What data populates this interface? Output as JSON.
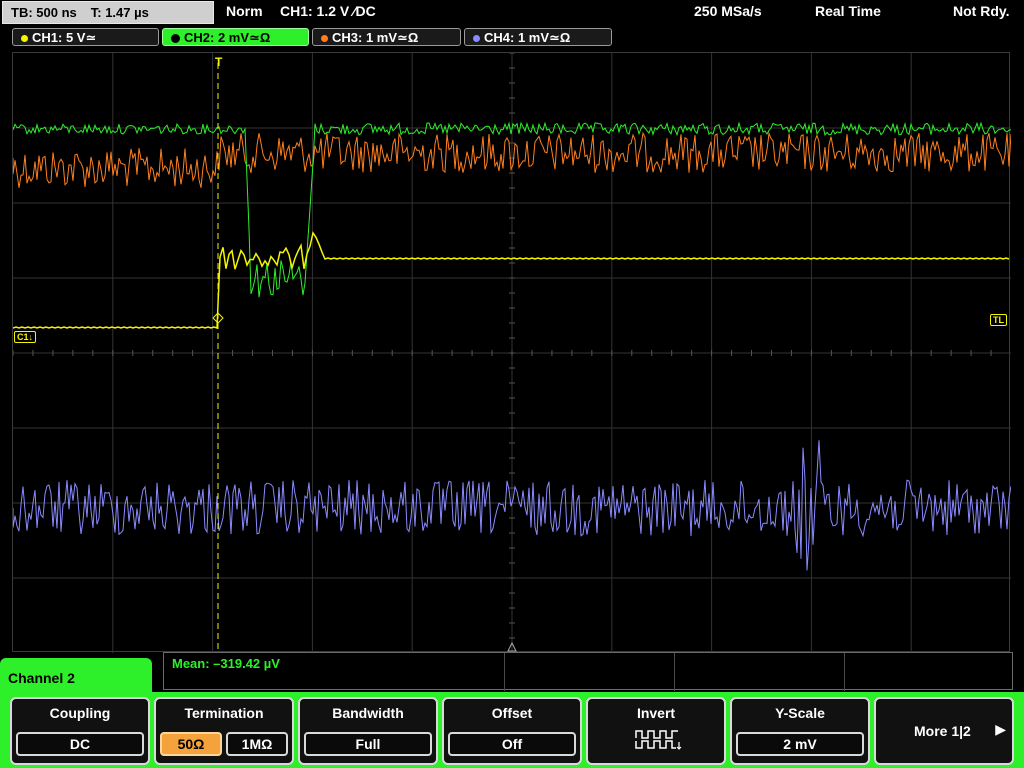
{
  "topbar": {
    "timebase": "TB: 500 ns",
    "trigger_time": "T: 1.47 µs",
    "trigger_mode": "Norm",
    "trigger_source": "CH1: 1.2 V ∕DC",
    "sample_rate": "250 MSa/s",
    "acq_mode": "Real Time",
    "status": "Not Rdy."
  },
  "channels": [
    {
      "label": "CH1: 5 V≃",
      "color": "#f5f500",
      "active": false
    },
    {
      "label": "CH2: 2 mV≃Ω",
      "color": "#2ef02a",
      "active": true
    },
    {
      "label": "CH3: 1 mV≃Ω",
      "color": "#ff7f1f",
      "active": false
    },
    {
      "label": "CH4: 1 mV≃Ω",
      "color": "#8a8aff",
      "active": false
    }
  ],
  "plot": {
    "markers": {
      "ch1_ref": "C1↓",
      "trigger_level": "TL",
      "trigger_pos": "T"
    }
  },
  "measurement": {
    "mean": "Mean: –319.42 µV"
  },
  "menu": {
    "channel_title": "Channel 2",
    "coupling": {
      "title": "Coupling",
      "value": "DC"
    },
    "termination": {
      "title": "Termination",
      "opt_50": "50Ω",
      "opt_1m": "1MΩ",
      "selected": "50Ω"
    },
    "bandwidth": {
      "title": "Bandwidth",
      "value": "Full"
    },
    "offset": {
      "title": "Offset",
      "value": "Off"
    },
    "invert": {
      "title": "Invert"
    },
    "yscale": {
      "title": "Y-Scale",
      "value": "2 mV"
    },
    "more": {
      "label": "More 1|2"
    }
  }
}
